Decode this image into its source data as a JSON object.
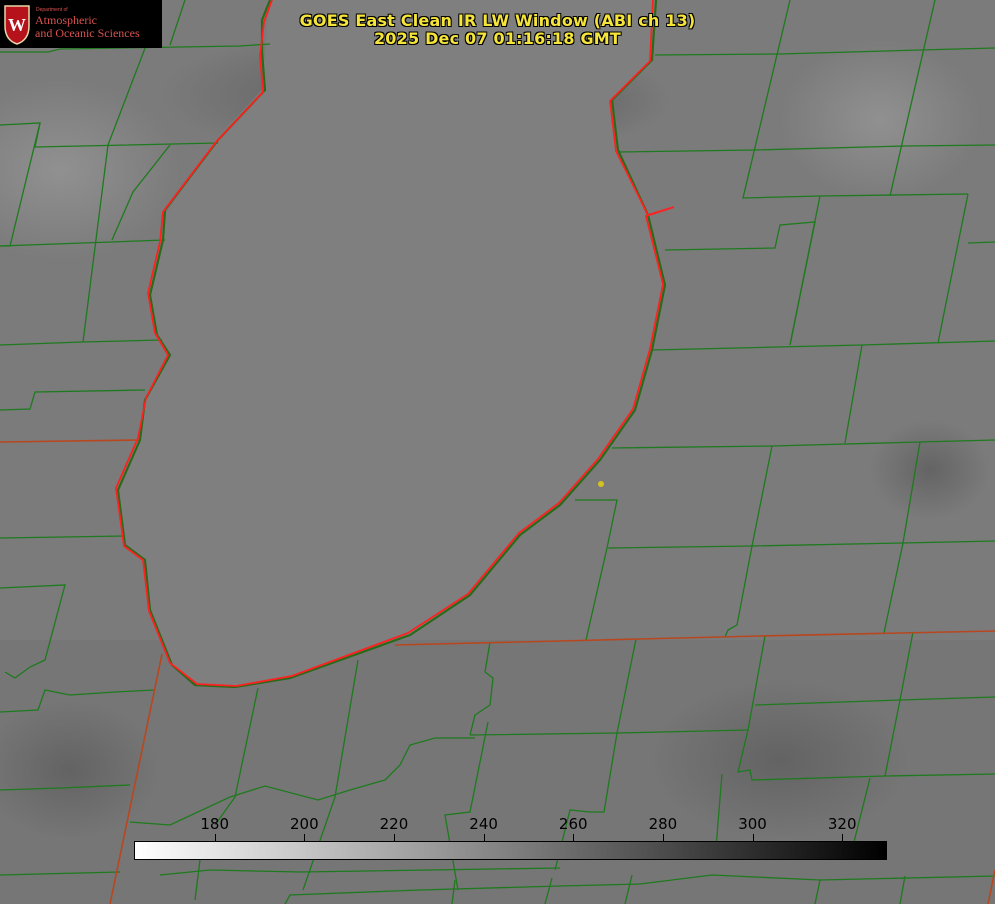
{
  "header": {
    "title_line1": "GOES East Clean IR LW Window (ABI ch 13)",
    "title_line2": "2025 Dec 07 01:16:18 GMT"
  },
  "logo": {
    "department": "Department of",
    "name_line1": "Atmospheric",
    "name_line2": "and Oceanic Sciences",
    "crest_letter": "W"
  },
  "colorbar": {
    "ticks": [
      "180",
      "200",
      "220",
      "240",
      "260",
      "280",
      "300",
      "320"
    ],
    "range": [
      162,
      330
    ],
    "gradient": "white-to-black"
  },
  "colors": {
    "title": "#f5e43a",
    "county_lines": "#1e7a1e",
    "state_lines": "#b8471f",
    "shoreline": "#ff2020",
    "station_dot": "#d4c21e",
    "background": "#7a7a7a"
  },
  "features": {
    "lake_outline": "shoreline",
    "boundaries": "county-lines"
  }
}
